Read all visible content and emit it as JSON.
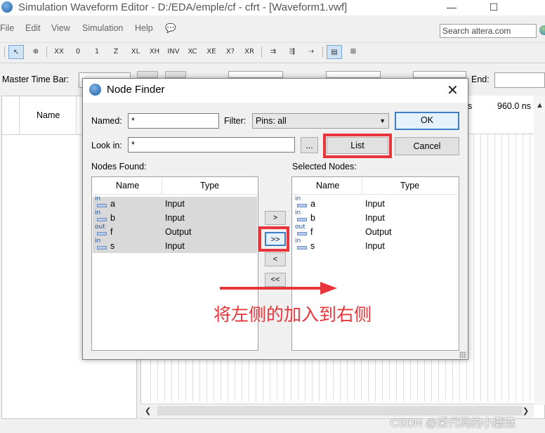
{
  "window": {
    "title": "Simulation Waveform Editor - D:/EDA/emple/cf - cfrt - [Waveform1.vwf]",
    "minimize_icon": "minimize-icon",
    "maximize_icon": "maximize-icon"
  },
  "menu": {
    "items": [
      "File",
      "Edit",
      "View",
      "Simulation",
      "Help"
    ]
  },
  "search": {
    "placeholder": "Search altera.com"
  },
  "time_bar": {
    "master_label": "Master Time Bar:",
    "end_label": "End:"
  },
  "waveform": {
    "name_header": "Name",
    "time_left": "s",
    "time_right": "960.0 ns"
  },
  "dialog": {
    "title": "Node Finder",
    "named_label": "Named:",
    "named_value": "*",
    "filter_label": "Filter:",
    "filter_value": "Pins: all",
    "look_in_label": "Look in:",
    "look_in_value": "*",
    "browse_label": "...",
    "list_button": "List",
    "ok_button": "OK",
    "cancel_button": "Cancel",
    "nodes_found_label": "Nodes Found:",
    "selected_nodes_label": "Selected Nodes:",
    "col_name": "Name",
    "col_type": "Type",
    "found_nodes": [
      {
        "icon": "in",
        "name": "a",
        "type": "Input"
      },
      {
        "icon": "in",
        "name": "b",
        "type": "Input"
      },
      {
        "icon": "out",
        "name": "f",
        "type": "Output"
      },
      {
        "icon": "in",
        "name": "s",
        "type": "Input"
      }
    ],
    "selected_nodes": [
      {
        "icon": "in",
        "name": "a",
        "type": "Input"
      },
      {
        "icon": "in",
        "name": "b",
        "type": "Input"
      },
      {
        "icon": "out",
        "name": "f",
        "type": "Output"
      },
      {
        "icon": "in",
        "name": "s",
        "type": "Input"
      }
    ],
    "move_buttons": [
      ">",
      ">>",
      "<",
      "<<"
    ]
  },
  "annotation": {
    "text": "将左侧的加入到右侧",
    "color": "#e8353a"
  },
  "watermark": "CSDN @采代码的小蘑菇",
  "colors": {
    "accent": "#3c7fc4",
    "highlight_box": "#e8353a",
    "row_selected": "#d9d9d9"
  }
}
